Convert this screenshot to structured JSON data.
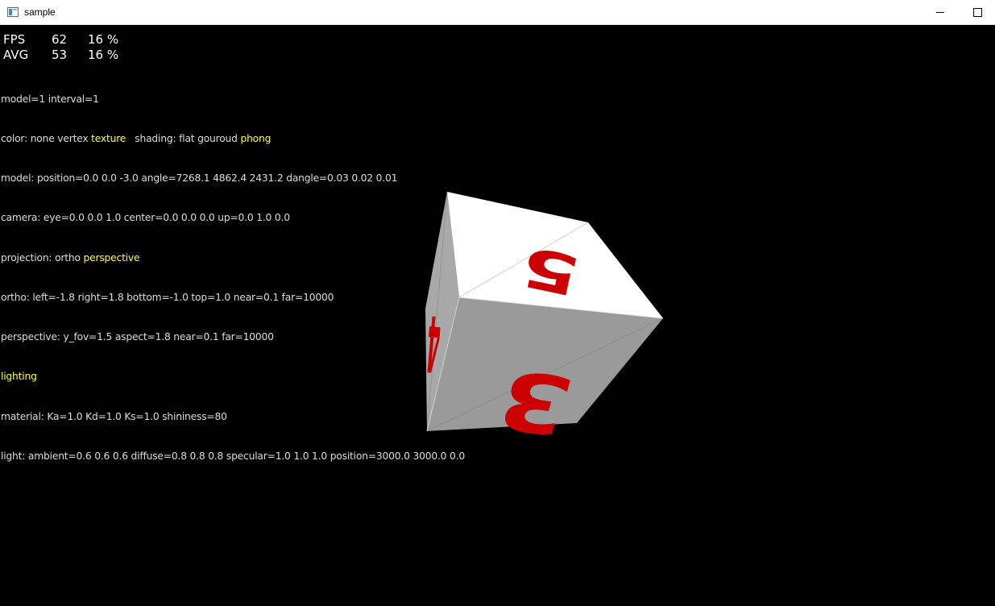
{
  "window": {
    "title": "sample"
  },
  "stats": {
    "fps": {
      "label": "FPS",
      "value": "62",
      "pct": "16 %"
    },
    "avg": {
      "label": "AVG",
      "value": "53",
      "pct": "16 %"
    }
  },
  "info": {
    "line1": "model=1 interval=1",
    "color_prefix": "color: none vertex ",
    "color_selected": "texture",
    "shading_prefix": "   shading: flat gouroud ",
    "shading_selected": "phong",
    "model": "model: position=0.0 0.0 -3.0 angle=7268.1 4862.4 2431.2 dangle=0.03 0.02 0.01",
    "camera": "camera: eye=0.0 0.0 1.0 center=0.0 0.0 0.0 up=0.0 1.0 0.0",
    "projection_prefix": "projection: ortho ",
    "projection_selected": "perspective",
    "ortho": "ortho: left=-1.8 right=1.8 bottom=-1.0 top=1.0 near=0.1 far=10000",
    "perspective": "perspective: y_fov=1.5 aspect=1.8 near=0.1 far=10000",
    "lighting": "lighting",
    "material": "material: Ka=1.0 Kd=1.0 Ks=1.0 shininess=80",
    "light": "light: ambient=0.6 0.6 0.6 diffuse=0.8 0.8 0.8 specular=1.0 1.0 1.0 position=3000.0 3000.0 0.0"
  },
  "cube": {
    "faces": {
      "top": {
        "number": "5",
        "color": "#ffffff"
      },
      "front": {
        "number": "3",
        "color": "#9a9a9a"
      },
      "left": {
        "number": "4",
        "color": "#a8a8a8"
      }
    },
    "digit_color": "#cc0000"
  },
  "colors": {
    "background": "#000000",
    "text": "#dcdcdc",
    "highlight": "#ffff33"
  }
}
